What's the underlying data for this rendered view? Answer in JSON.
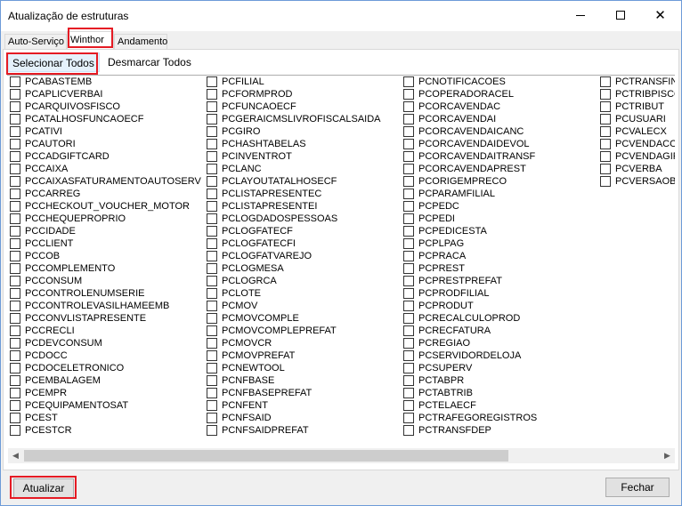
{
  "window": {
    "title": "Atualização de estruturas"
  },
  "tabs": [
    {
      "label": "Auto-Serviço"
    },
    {
      "label": "Winthor"
    },
    {
      "label": "Andamento"
    }
  ],
  "toolbar": {
    "select_all_label": "Selecionar Todos",
    "deselect_all_label": "Desmarcar Todos"
  },
  "columns": [
    [
      "PCABASTEMB",
      "PCAPLICVERBAI",
      "PCARQUIVOSFISCO",
      "PCATALHOSFUNCAOECF",
      "PCATIVI",
      "PCAUTORI",
      "PCCADGIFTCARD",
      "PCCAIXA",
      "PCCAIXASFATURAMENTOAUTOSERV",
      "PCCARREG",
      "PCCHECKOUT_VOUCHER_MOTOR",
      "PCCHEQUEPROPRIO",
      "PCCIDADE",
      "PCCLIENT",
      "PCCOB",
      "PCCOMPLEMENTO",
      "PCCONSUM",
      "PCCONTROLENUMSERIE",
      "PCCONTROLEVASILHAMEEMB",
      "PCCONVLISTAPRESENTE",
      "PCCRECLI",
      "PCDEVCONSUM",
      "PCDOCC",
      "PCDOCELETRONICO",
      "PCEMBALAGEM",
      "PCEMPR",
      "PCEQUIPAMENTOSAT",
      "PCEST",
      "PCESTCR"
    ],
    [
      "PCFILIAL",
      "PCFORMPROD",
      "PCFUNCAOECF",
      "PCGERAICMSLIVROFISCALSAIDA",
      "PCGIRO",
      "PCHASHTABELAS",
      "PCINVENTROT",
      "PCLANC",
      "PCLAYOUTATALHOSECF",
      "PCLISTAPRESENTEC",
      "PCLISTAPRESENTEI",
      "PCLOGDADOSPESSOAS",
      "PCLOGFATECF",
      "PCLOGFATECFI",
      "PCLOGFATVAREJO",
      "PCLOGMESA",
      "PCLOGRCA",
      "PCLOTE",
      "PCMOV",
      "PCMOVCOMPLE",
      "PCMOVCOMPLEPREFAT",
      "PCMOVCR",
      "PCMOVPREFAT",
      "PCNEWTOOL",
      "PCNFBASE",
      "PCNFBASEPREFAT",
      "PCNFENT",
      "PCNFSAID",
      "PCNFSAIDPREFAT"
    ],
    [
      "PCNOTIFICACOES",
      "PCOPERADORACEL",
      "PCORCAVENDAC",
      "PCORCAVENDAI",
      "PCORCAVENDAICANC",
      "PCORCAVENDAIDEVOL",
      "PCORCAVENDAITRANSF",
      "PCORCAVENDAPREST",
      "PCORIGEMPRECO",
      "PCPARAMFILIAL",
      "PCPEDC",
      "PCPEDI",
      "PCPEDICESTA",
      "PCPLPAG",
      "PCPRACA",
      "PCPREST",
      "PCPRESTPREFAT",
      "PCPRODFILIAL",
      "PCPRODUT",
      "PCRECALCULOPROD",
      "PCRECFATURA",
      "PCREGIAO",
      "PCSERVIDORDELOJA",
      "PCSUPERV",
      "PCTABPR",
      "PCTABTRIB",
      "PCTELAECF",
      "PCTRAFEGOREGISTROS",
      "PCTRANSFDEP"
    ],
    [
      "PCTRANSFIN",
      "PCTRIBPISCO",
      "PCTRIBUT",
      "PCUSUARI",
      "PCVALECX",
      "PCVENDACO",
      "PCVENDAGIF",
      "PCVERBA",
      "PCVERSAOBI"
    ]
  ],
  "buttons": {
    "update_label": "Atualizar",
    "close_label": "Fechar"
  }
}
